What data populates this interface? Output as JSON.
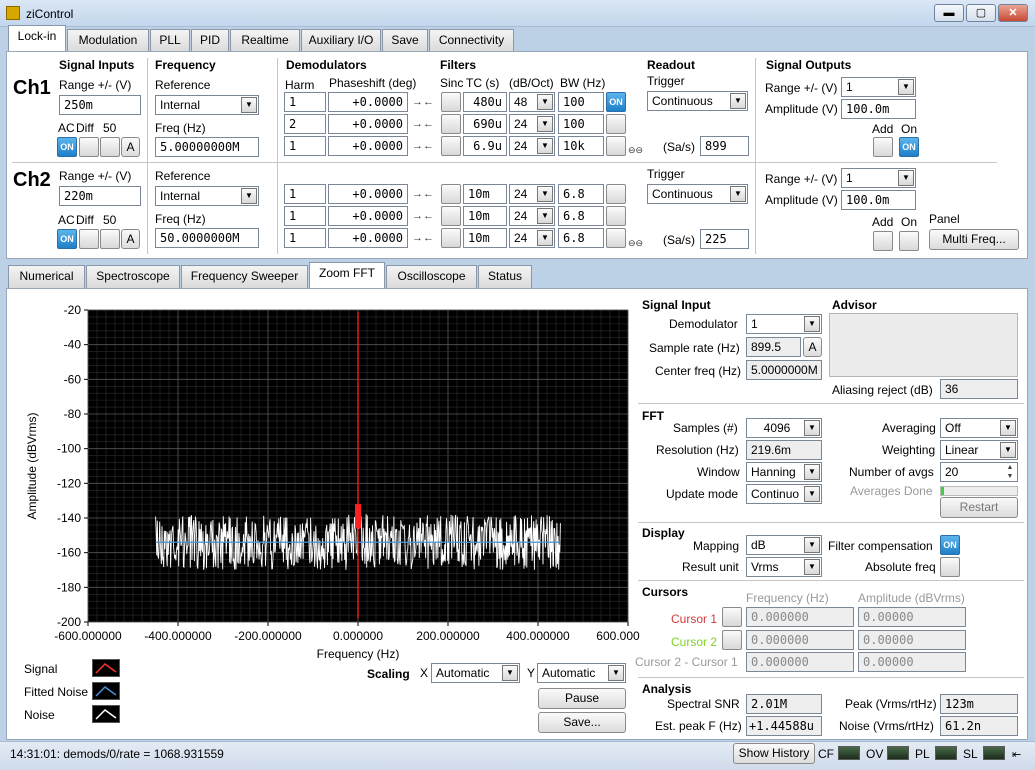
{
  "window": {
    "title": "ziControl",
    "minimize": "▬",
    "maximize": "▢",
    "close": "✕"
  },
  "main_tabs": [
    "Lock-in",
    "Modulation",
    "PLL",
    "PID",
    "Realtime",
    "Auxiliary I/O",
    "Save",
    "Connectivity"
  ],
  "headers": {
    "signal_inputs": "Signal Inputs",
    "frequency": "Frequency",
    "demodulators": "Demodulators",
    "filters": "Filters",
    "readout": "Readout",
    "signal_outputs": "Signal Outputs"
  },
  "labels": {
    "range_v": "Range +/- (V)",
    "ac": "AC",
    "diff": "Diff",
    "fifty": "50",
    "reference": "Reference",
    "freq_hz": "Freq (Hz)",
    "harm": "Harm",
    "phaseshift": "Phaseshift (deg)",
    "sinc": "Sinc",
    "tc": "TC (s)",
    "dboct": "(dB/Oct)",
    "bw": "BW (Hz)",
    "trigger": "Trigger",
    "sas": "(Sa/s)",
    "range_out": "Range +/- (V)",
    "amplitude": "Amplitude (V)",
    "add": "Add",
    "on": "On",
    "panel": "Panel",
    "on_btn": "ON",
    "a_btn": "A"
  },
  "ch1": {
    "name": "Ch1",
    "range": "250m",
    "reference": "Internal",
    "freq": "5.00000000M",
    "demods": [
      {
        "harm": "1",
        "phase": "+0.0000",
        "tc": "480u",
        "order": "48",
        "bw": "100"
      },
      {
        "harm": "2",
        "phase": "+0.0000",
        "tc": "690u",
        "order": "24",
        "bw": "100"
      },
      {
        "harm": "1",
        "phase": "+0.0000",
        "tc": "6.9u",
        "order": "24",
        "bw": "10k"
      }
    ],
    "trigger": "Continuous",
    "rate": "899",
    "out_range": "1",
    "amplitude": "100.0m"
  },
  "ch2": {
    "name": "Ch2",
    "range": "220m",
    "reference": "Internal",
    "freq": "50.0000000M",
    "demods": [
      {
        "harm": "1",
        "phase": "+0.0000",
        "tc": "10m",
        "order": "24",
        "bw": "6.8"
      },
      {
        "harm": "1",
        "phase": "+0.0000",
        "tc": "10m",
        "order": "24",
        "bw": "6.8"
      },
      {
        "harm": "1",
        "phase": "+0.0000",
        "tc": "10m",
        "order": "24",
        "bw": "6.8"
      }
    ],
    "trigger": "Continuous",
    "rate": "225",
    "out_range": "1",
    "amplitude": "100.0m",
    "multi_freq": "Multi Freq..."
  },
  "sub_tabs": [
    "Numerical",
    "Spectroscope",
    "Frequency Sweeper",
    "Zoom FFT",
    "Oscilloscope",
    "Status"
  ],
  "chart_data": {
    "type": "line",
    "title": "",
    "xlabel": "Frequency (Hz)",
    "ylabel": "Amplitude (dBVrms)",
    "xlim": [
      -600,
      600
    ],
    "ylim": [
      -200,
      -20
    ],
    "x_ticks": [
      "-600.000000",
      "-400.000000",
      "-200.000000",
      "0.000000",
      "200.000000",
      "400.000000",
      "600.000000"
    ],
    "y_ticks": [
      "-20",
      "-40",
      "-60",
      "-80",
      "-100",
      "-120",
      "-140",
      "-160",
      "-180",
      "-200"
    ],
    "grid": true,
    "series": [
      {
        "name": "Noise",
        "color": "#ffffff",
        "x_range": [
          -449.75,
          449.75
        ],
        "mean": -152,
        "min": -170,
        "max": -138
      },
      {
        "name": "Fitted Noise",
        "color": "#4a90d9",
        "x_range": [
          -449.75,
          449.75
        ],
        "values": [
          -154,
          -154
        ]
      },
      {
        "name": "Signal",
        "color": "#ff2020",
        "x": [
          0,
          0
        ],
        "values": [
          -198,
          -21
        ]
      }
    ],
    "legend": [
      "Signal",
      "Fitted Noise",
      "Noise"
    ]
  },
  "scaling": {
    "label": "Scaling",
    "x_label": "X",
    "x_value": "Automatic",
    "y_label": "Y",
    "y_value": "Automatic"
  },
  "buttons": {
    "pause": "Pause",
    "save": "Save...",
    "restart": "Restart",
    "show_history": "Show History",
    "a": "A"
  },
  "signal_input": {
    "header": "Signal Input",
    "demod_label": "Demodulator",
    "demod": "1",
    "rate_label": "Sample rate (Hz)",
    "rate": "899.5",
    "center_label": "Center freq (Hz)",
    "center": "5.0000000M"
  },
  "advisor": {
    "header": "Advisor",
    "alias_label": "Aliasing reject (dB)",
    "alias": "36"
  },
  "fft": {
    "header": "FFT",
    "samples_label": "Samples (#)",
    "samples": "4096",
    "res_label": "Resolution (Hz)",
    "res": "219.6m",
    "window_label": "Window",
    "window": "Hanning",
    "update_label": "Update mode",
    "update": "Continuo",
    "avg_label": "Averaging",
    "avg": "Off",
    "weight_label": "Weighting",
    "weight": "Linear",
    "navg_label": "Number of avgs",
    "navg": "20",
    "done_label": "Averages Done"
  },
  "display": {
    "header": "Display",
    "mapping_label": "Mapping",
    "mapping": "dB",
    "unit_label": "Result unit",
    "unit": "Vrms",
    "filter_label": "Filter compensation",
    "abs_label": "Absolute freq"
  },
  "cursors": {
    "header": "Cursors",
    "freq_h": "Frequency (Hz)",
    "amp_h": "Amplitude (dBVrms)",
    "c1": "Cursor 1",
    "c2": "Cursor 2",
    "diff": "Cursor 2 - Cursor 1",
    "f1": "0.000000",
    "a1": "0.00000",
    "f2": "0.000000",
    "a2": "0.00000",
    "fd": "0.000000",
    "ad": "0.00000"
  },
  "analysis": {
    "header": "Analysis",
    "snr_label": "Spectral SNR",
    "snr": "2.01M",
    "peakf_label": "Est. peak F (Hz)",
    "peakf": "+1.44588u",
    "peak_label": "Peak (Vrms/rtHz)",
    "peak": "123m",
    "noise_label": "Noise (Vrms/rtHz)",
    "noise": "61.2n"
  },
  "status": {
    "message": "14:31:01: demods/0/rate = 1068.931559",
    "leds": [
      "CF",
      "OV",
      "PL",
      "SL"
    ]
  }
}
